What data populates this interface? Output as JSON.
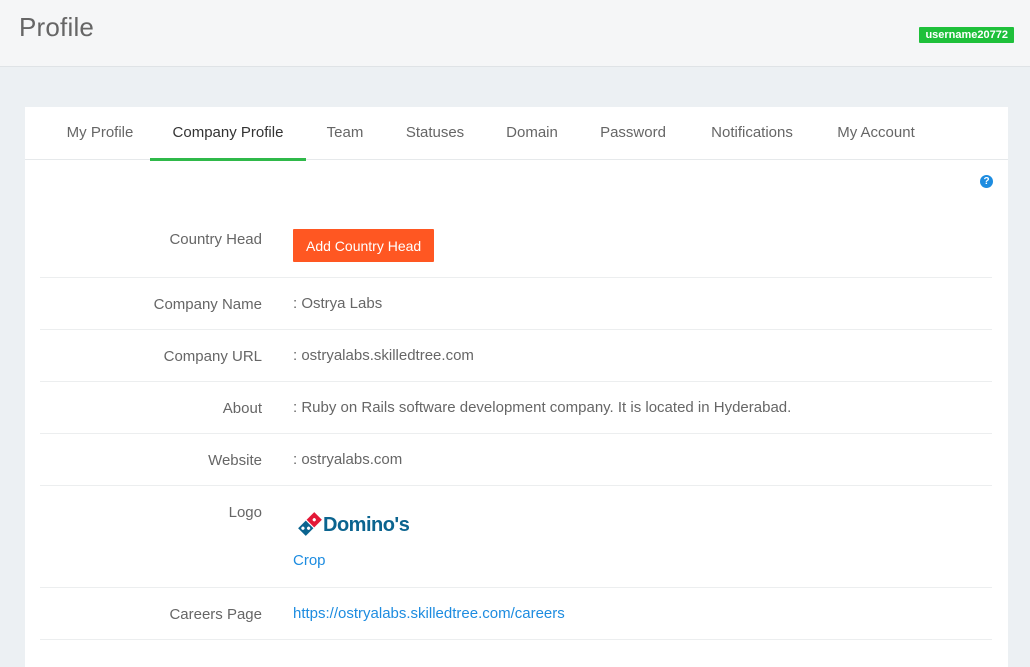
{
  "header": {
    "title": "Profile",
    "username": "username20772"
  },
  "tabs": [
    {
      "label": "My Profile"
    },
    {
      "label": "Company Profile",
      "active": true
    },
    {
      "label": "Team"
    },
    {
      "label": "Statuses"
    },
    {
      "label": "Domain"
    },
    {
      "label": "Password"
    },
    {
      "label": "Notifications"
    },
    {
      "label": "My Account"
    }
  ],
  "help_icon": "question-circle-icon",
  "fields": {
    "country_head": {
      "label": "Country Head",
      "button": "Add Country Head"
    },
    "company_name": {
      "label": "Company Name",
      "value": ": Ostrya Labs"
    },
    "company_url": {
      "label": "Company URL",
      "value": ": ostryalabs.skilledtree.com"
    },
    "about": {
      "label": "About",
      "value": ": Ruby on Rails software development company. It is located in Hyderabad."
    },
    "website": {
      "label": "Website",
      "value": ": ostryalabs.com"
    },
    "logo": {
      "label": "Logo",
      "logo_text": "Domino's",
      "crop_link": "Crop"
    },
    "careers_page": {
      "label": "Careers Page",
      "link": "https://ostryalabs.skilledtree.com/careers"
    }
  },
  "colors": {
    "accent_green": "#2fb94a",
    "badge_green": "#1ec03a",
    "button_orange": "#ff5722",
    "link_blue": "#1d8ce0",
    "logo_blue": "#0b648f",
    "logo_red": "#e31837"
  }
}
